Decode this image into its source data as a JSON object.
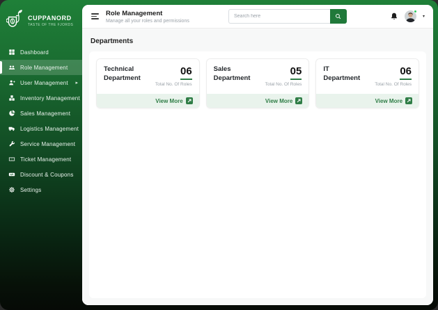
{
  "brand": {
    "name": "CUPPANORD",
    "tagline": "TASTE OF THE FJORDS"
  },
  "sidebar": {
    "items": [
      {
        "label": "Dashboard",
        "icon": "dashboard-icon",
        "active": false,
        "has_submenu": false
      },
      {
        "label": "Role Management",
        "icon": "roles-icon",
        "active": true,
        "has_submenu": false
      },
      {
        "label": "User Management",
        "icon": "user-icon",
        "active": false,
        "has_submenu": true
      },
      {
        "label": "Inventory Management",
        "icon": "inventory-icon",
        "active": false,
        "has_submenu": true
      },
      {
        "label": "Sales Management",
        "icon": "pie-chart-icon",
        "active": false,
        "has_submenu": false
      },
      {
        "label": "Logistics Management",
        "icon": "truck-icon",
        "active": false,
        "has_submenu": false
      },
      {
        "label": "Service Management",
        "icon": "wrench-icon",
        "active": false,
        "has_submenu": false
      },
      {
        "label": "Ticket Management",
        "icon": "ticket-icon",
        "active": false,
        "has_submenu": false
      },
      {
        "label": "Discount & Coupons",
        "icon": "coupon-icon",
        "active": false,
        "has_submenu": false
      },
      {
        "label": "Settings",
        "icon": "gear-icon",
        "active": false,
        "has_submenu": false
      }
    ]
  },
  "header": {
    "title": "Role Management",
    "subtitle": "Manage all your roles and permissions",
    "search_placeholder": "Search here"
  },
  "main": {
    "section_title": "Departments",
    "cards": [
      {
        "title": "Technical Department",
        "count": "06",
        "count_label": "Total No. Of Roles",
        "action": "View More"
      },
      {
        "title": "Sales Department",
        "count": "05",
        "count_label": "Total No. Of Roles",
        "action": "View More"
      },
      {
        "title": "IT Department",
        "count": "06",
        "count_label": "Total No. Of Roles",
        "action": "View More"
      }
    ]
  },
  "colors": {
    "accent_green": "#20793a",
    "sidebar_top": "#1f8038",
    "sidebar_bottom": "#060a06",
    "active_item_overlay": "rgba(255,255,255,0.17)",
    "count_underline": "#2f7d46",
    "card_footer_bg": "#e9f3ec",
    "content_bg": "#f7f8f8",
    "online_dot": "#2ecc5e"
  }
}
